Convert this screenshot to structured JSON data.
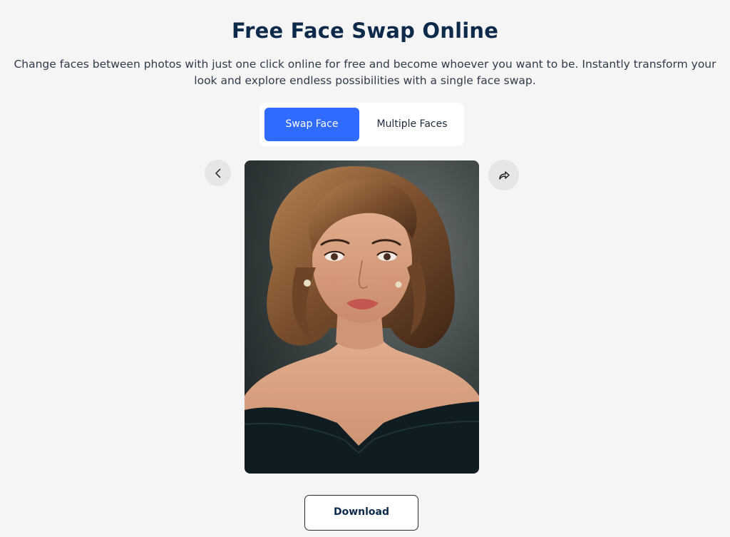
{
  "header": {
    "title": "Free Face Swap Online",
    "subtitle": "Change faces between photos with just one click online for free and become whoever you want to be. Instantly transform your look and explore endless possibilities with a single face swap."
  },
  "tabs": [
    {
      "label": "Swap Face",
      "active": true
    },
    {
      "label": "Multiple Faces",
      "active": false
    }
  ],
  "viewer": {
    "prev_icon": "chevron-left-icon",
    "share_icon": "share-arrow-icon",
    "image_subject": "portrait-woman-off-shoulder-dress"
  },
  "actions": {
    "download_label": "Download"
  },
  "colors": {
    "accent": "#2f6bff",
    "title": "#0e2a4a",
    "background": "#f5f5f5"
  }
}
